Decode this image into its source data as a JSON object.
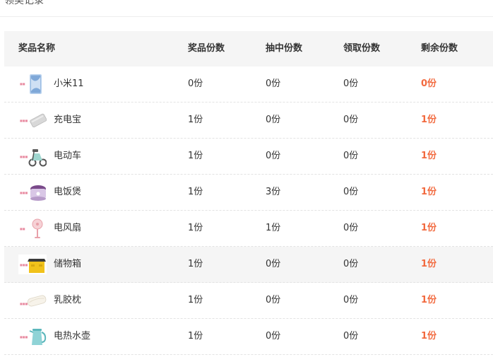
{
  "page": {
    "title": "领奖记录"
  },
  "table": {
    "headers": {
      "name": "奖品名称",
      "total": "奖品份数",
      "drawn": "抽中份数",
      "claimed": "领取份数",
      "remaining": "剩余份数"
    },
    "rows": [
      {
        "name": "小米11",
        "image": "phone-image",
        "total": "0份",
        "drawn": "0份",
        "claimed": "0份",
        "remaining": "0份"
      },
      {
        "name": "充电宝",
        "image": "power-bank-image",
        "total": "1份",
        "drawn": "0份",
        "claimed": "0份",
        "remaining": "1份"
      },
      {
        "name": "电动车",
        "image": "e-scooter-image",
        "total": "1份",
        "drawn": "0份",
        "claimed": "0份",
        "remaining": "1份"
      },
      {
        "name": "电饭煲",
        "image": "rice-cooker-image",
        "total": "1份",
        "drawn": "3份",
        "claimed": "0份",
        "remaining": "1份"
      },
      {
        "name": "电风扇",
        "image": "fan-image",
        "total": "1份",
        "drawn": "1份",
        "claimed": "0份",
        "remaining": "1份"
      },
      {
        "name": "储物箱",
        "image": "storage-box-image",
        "total": "1份",
        "drawn": "0份",
        "claimed": "0份",
        "remaining": "1份"
      },
      {
        "name": "乳胶枕",
        "image": "pillow-image",
        "total": "1份",
        "drawn": "0份",
        "claimed": "0份",
        "remaining": "1份"
      },
      {
        "name": "电热水壶",
        "image": "kettle-image",
        "total": "1份",
        "drawn": "0份",
        "claimed": "0份",
        "remaining": "1份"
      }
    ]
  },
  "colors": {
    "remaining_accent": "#f26a3f",
    "header_bg": "#f5f5f5",
    "hover_row_bg": "#f5f5f5"
  }
}
